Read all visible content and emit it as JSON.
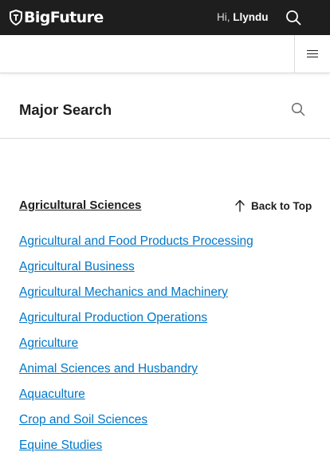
{
  "header": {
    "logo_text": "BigFuture",
    "greeting_prefix": "Hi,",
    "user_name": "Llyndu"
  },
  "search_section": {
    "title": "Major Search"
  },
  "category": {
    "title": "Agricultural Sciences",
    "back_to_top": "Back to Top"
  },
  "majors": [
    "Agricultural and Food Products Processing",
    "Agricultural Business",
    "Agricultural Mechanics and Machinery",
    "Agricultural Production Operations",
    "Agriculture",
    "Animal Sciences and Husbandry",
    "Aquaculture",
    "Crop and Soil Sciences",
    "Equine Studies"
  ],
  "colors": {
    "topbar": "#1e1e1e",
    "link": "#0077c8",
    "text": "#1e1e1e",
    "divider": "#d9d9d9"
  },
  "icons": [
    "shield-logo-icon",
    "search-icon",
    "hamburger-menu-icon",
    "arrow-up-icon"
  ]
}
